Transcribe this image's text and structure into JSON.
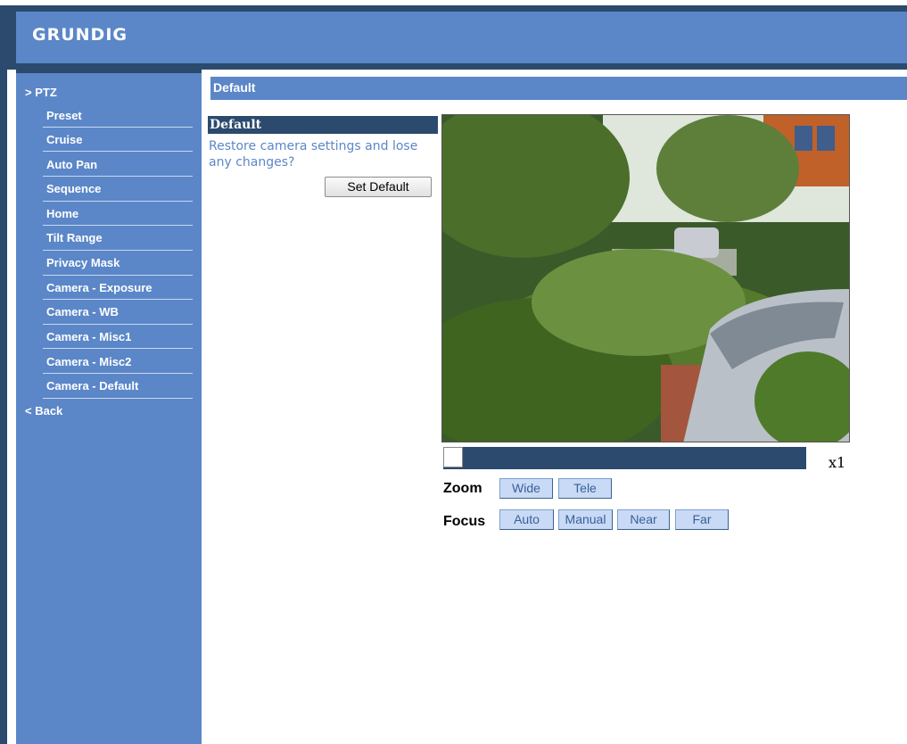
{
  "brand": {
    "logo": "GRUNDIG"
  },
  "sidebar": {
    "header": "> PTZ",
    "items": [
      {
        "label": "Preset"
      },
      {
        "label": "Cruise"
      },
      {
        "label": "Auto Pan"
      },
      {
        "label": "Sequence"
      },
      {
        "label": "Home"
      },
      {
        "label": "Tilt Range"
      },
      {
        "label": "Privacy Mask"
      },
      {
        "label": "Camera - Exposure"
      },
      {
        "label": "Camera - WB"
      },
      {
        "label": "Camera - Misc1"
      },
      {
        "label": "Camera - Misc2"
      },
      {
        "label": "Camera - Default"
      }
    ],
    "back": "< Back"
  },
  "content": {
    "title": "Default",
    "panel": {
      "heading": "Default",
      "description": "Restore camera settings and lose any changes?",
      "button": "Set Default"
    }
  },
  "camera": {
    "zoom_level": "x1",
    "zoom_position": 0,
    "zoom_label": "Zoom",
    "zoom_buttons": [
      "Wide",
      "Tele"
    ],
    "focus_label": "Focus",
    "focus_buttons": [
      "Auto",
      "Manual",
      "Near",
      "Far"
    ]
  },
  "colors": {
    "header_dark": "#2b4a6d",
    "accent": "#5b87c8",
    "button_face": "#c8daf5"
  }
}
